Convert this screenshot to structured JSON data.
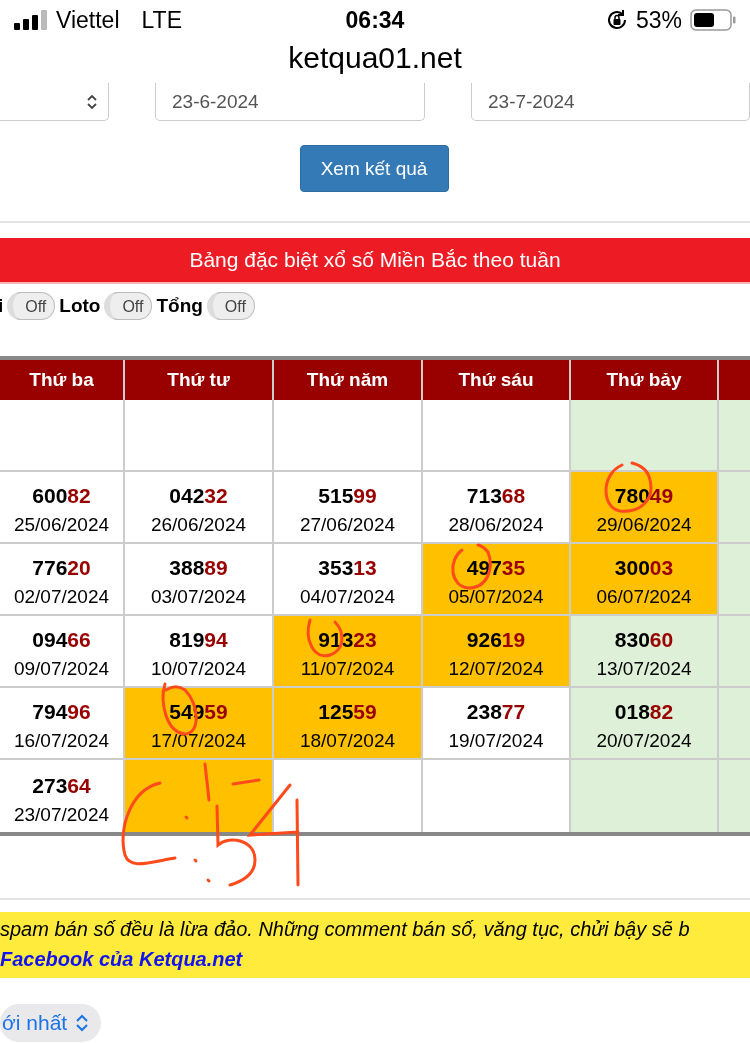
{
  "status_bar": {
    "carrier": "Viettel",
    "network": "LTE",
    "time": "06:34",
    "battery": "53%"
  },
  "address_bar": {
    "url": "ketqua01.net"
  },
  "filter": {
    "from_date": "23-6-2024",
    "to_date": "23-7-2024",
    "submit": "Xem kết quả"
  },
  "banner": {
    "title": "Bảng đặc biệt xổ số Miền Bắc theo tuần"
  },
  "toggles": [
    {
      "label": "i",
      "state": "Off",
      "on": false
    },
    {
      "label": "Loto",
      "state": "Off",
      "on": false
    },
    {
      "label": "Tổng",
      "state": "Off",
      "on": false
    }
  ],
  "table": {
    "columns": [
      {
        "label": "Thứ ba",
        "weekend": false
      },
      {
        "label": "Thứ tư",
        "weekend": false
      },
      {
        "label": "Thứ năm",
        "weekend": false
      },
      {
        "label": "Thứ sáu",
        "weekend": false
      },
      {
        "label": "Thứ bảy",
        "weekend": true
      },
      {
        "weekend": true
      }
    ],
    "rows": [
      [
        {
          "highlighted": false
        },
        {
          "highlighted": false
        },
        {
          "highlighted": false
        },
        {
          "highlighted": false
        },
        {
          "highlighted": false
        },
        {
          "highlighted": false
        }
      ],
      [
        {
          "number": "60082",
          "date": "25/06/2024",
          "highlighted": false
        },
        {
          "number": "04232",
          "date": "26/06/2024",
          "highlighted": false
        },
        {
          "number": "51599",
          "date": "27/06/2024",
          "highlighted": false
        },
        {
          "number": "71368",
          "date": "28/06/2024",
          "highlighted": false
        },
        {
          "number": "78049",
          "date": "29/06/2024",
          "highlighted": true
        },
        {
          "highlighted": false
        }
      ],
      [
        {
          "number": "77620",
          "date": "02/07/2024",
          "highlighted": false
        },
        {
          "number": "38889",
          "date": "03/07/2024",
          "highlighted": false
        },
        {
          "number": "35313",
          "date": "04/07/2024",
          "highlighted": false
        },
        {
          "number": "49735",
          "date": "05/07/2024",
          "highlighted": true
        },
        {
          "number": "30003",
          "date": "06/07/2024",
          "highlighted": true
        },
        {
          "highlighted": false
        }
      ],
      [
        {
          "number": "09466",
          "date": "09/07/2024",
          "highlighted": false
        },
        {
          "number": "81994",
          "date": "10/07/2024",
          "highlighted": false
        },
        {
          "number": "91323",
          "date": "11/07/2024",
          "highlighted": true
        },
        {
          "number": "92619",
          "date": "12/07/2024",
          "highlighted": true
        },
        {
          "number": "83060",
          "date": "13/07/2024",
          "highlighted": false
        },
        {
          "highlighted": false
        }
      ],
      [
        {
          "number": "79496",
          "date": "16/07/2024",
          "highlighted": false
        },
        {
          "number": "54959",
          "date": "17/07/2024",
          "highlighted": true
        },
        {
          "number": "12559",
          "date": "18/07/2024",
          "highlighted": true
        },
        {
          "number": "23877",
          "date": "19/07/2024",
          "highlighted": false
        },
        {
          "number": "01882",
          "date": "20/07/2024",
          "highlighted": false
        },
        {
          "highlighted": false
        }
      ],
      [
        {
          "number": "27364",
          "date": "23/07/2024",
          "highlighted": false
        },
        {
          "highlighted": true
        },
        {
          "highlighted": false
        },
        {
          "highlighted": false
        },
        {
          "highlighted": false
        },
        {
          "highlighted": false
        }
      ]
    ]
  },
  "notice": {
    "text": "spam bán số đều là lừa đảo. Những comment bán số, văng tục, chửi bậy sẽ b",
    "link": "Facebook của Ketqua.net"
  },
  "sort": {
    "label": "ới nhất"
  }
}
